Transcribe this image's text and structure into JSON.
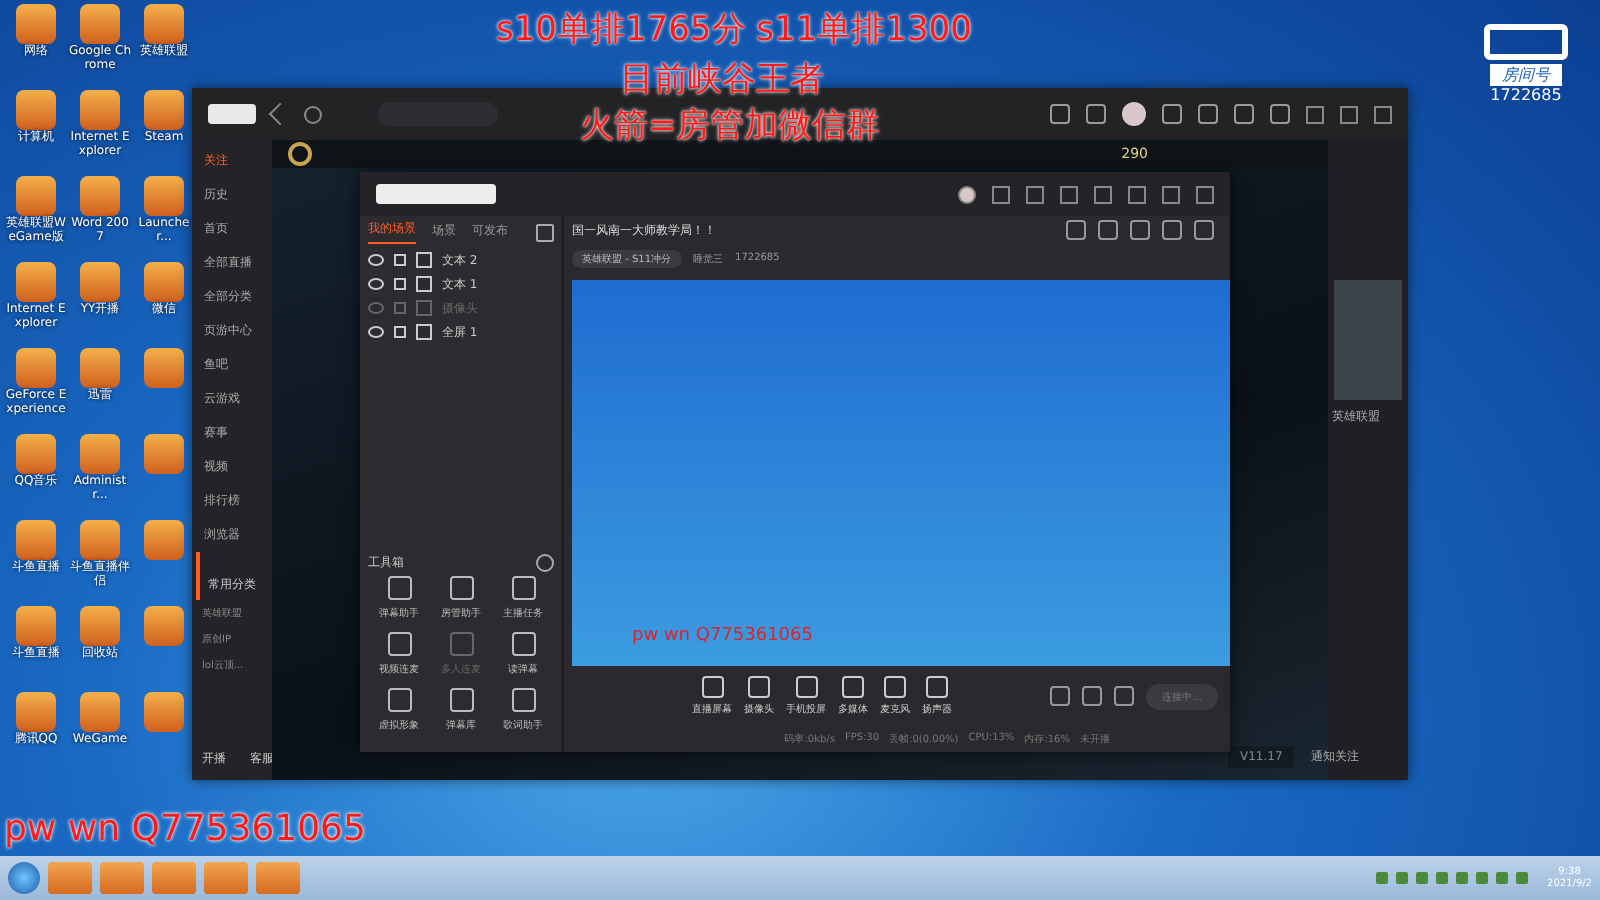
{
  "desktop_icon_rows": [
    [
      "网络",
      "Google Chrome",
      "英雄联盟"
    ],
    [
      "计算机",
      "Internet Explorer",
      "Steam"
    ],
    [
      "英雄联盟WeGame版",
      "Word 2007",
      "Launcher..."
    ],
    [
      "Internet Explorer",
      "YY开播",
      "微信"
    ],
    [
      "GeForce Experience",
      "迅雷"
    ],
    [
      "QQ音乐",
      "Administr..."
    ],
    [
      "斗鱼直播",
      "斗鱼直播伴侣"
    ],
    [
      "斗鱼直播",
      "回收站"
    ],
    [
      "腾讯QQ",
      "WeGame"
    ]
  ],
  "overlay_texts": [
    "s10单排1765分  s11单排1300",
    "目前峡谷王者",
    "火箭=房管加微信群"
  ],
  "contact": "pw wn Q775361065",
  "room_badge": {
    "label": "房间号",
    "number": "1722685"
  },
  "client": {
    "sidebar": [
      {
        "label": "关注",
        "selected": true
      },
      {
        "label": "历史",
        "selected": false
      },
      {
        "label": "首页",
        "selected": false
      },
      {
        "label": "全部直播",
        "selected": false
      },
      {
        "label": "全部分类",
        "selected": false
      },
      {
        "label": "页游中心",
        "selected": false
      },
      {
        "label": "鱼吧",
        "selected": false
      },
      {
        "label": "云游戏",
        "selected": false
      },
      {
        "label": "赛事",
        "selected": false
      },
      {
        "label": "视频",
        "selected": false
      },
      {
        "label": "排行榜",
        "selected": false
      },
      {
        "label": "浏览器",
        "selected": false
      }
    ],
    "common_title": "常用分类",
    "common": [
      "英雄联盟",
      "原创IP",
      "lol云顶..."
    ],
    "bottom": [
      "开播",
      "客服"
    ],
    "coins": "290",
    "right_game": "英雄联盟",
    "version": "V11.17",
    "notice": "通知关注"
  },
  "companion": {
    "scene_tabs": [
      {
        "label": "我的场景",
        "selected": true
      },
      {
        "label": "场景",
        "selected": false
      },
      {
        "label": "可发布",
        "selected": false
      }
    ],
    "scenes": [
      {
        "label": "文本 2",
        "disabled": false
      },
      {
        "label": "文本 1",
        "disabled": false
      },
      {
        "label": "摄像头",
        "disabled": true
      },
      {
        "label": "全屏 1",
        "disabled": false
      }
    ],
    "toolbox": "工具箱",
    "tools": [
      {
        "label": "弹幕助手",
        "disabled": false
      },
      {
        "label": "房管助手",
        "disabled": false
      },
      {
        "label": "主播任务",
        "disabled": false
      },
      {
        "label": "视频连麦",
        "disabled": false
      },
      {
        "label": "多人连麦",
        "disabled": true
      },
      {
        "label": "读弹幕",
        "disabled": false
      },
      {
        "label": "虚拟形象",
        "disabled": false
      },
      {
        "label": "弹幕库",
        "disabled": false
      },
      {
        "label": "歌词助手",
        "disabled": false
      }
    ],
    "stream_title": "国一风南一大师教学局！！",
    "category": "英雄联盟 - S11冲分",
    "streamer": "睡觉三",
    "room": "1722685",
    "preview_contact": "pw wn Q775361065",
    "controls": [
      "直播屏幕",
      "摄像头",
      "手机投屏",
      "多媒体",
      "麦克风",
      "扬声器"
    ],
    "go_live": "连接中...",
    "status": [
      "码率:0kb/s",
      "FPS:30",
      "丢帧:0(0.00%)",
      "CPU:13%",
      "内存:16%",
      "未开播"
    ]
  },
  "taskbar": {
    "time": "9:38",
    "date": "2021/9/2"
  }
}
